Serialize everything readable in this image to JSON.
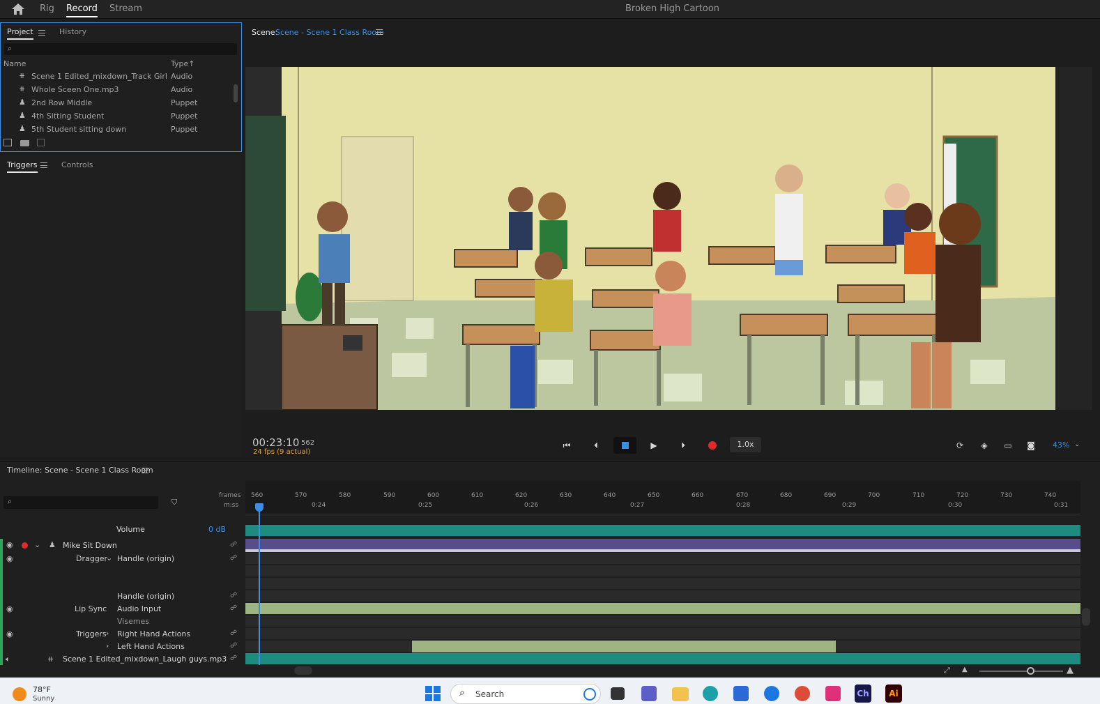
{
  "topbar": {
    "nav": [
      "Rig",
      "Record",
      "Stream"
    ],
    "active": "Record",
    "app_title": "Broken High Cartoon"
  },
  "project_panel": {
    "tabs": [
      "Project",
      "History"
    ],
    "columns": {
      "name": "Name",
      "type": "Type"
    },
    "items": [
      {
        "name": "Scene 1 Edited_mixdown_Track Girls...",
        "type": "Audio",
        "icon": "audio-icon"
      },
      {
        "name": "Whole Sceen One.mp3",
        "type": "Audio",
        "icon": "audio-icon"
      },
      {
        "name": "2nd Row Middle",
        "type": "Puppet",
        "icon": "puppet-icon"
      },
      {
        "name": "4th Sitting Student",
        "type": "Puppet",
        "icon": "puppet-icon"
      },
      {
        "name": "5th Student sitting down",
        "type": "Puppet",
        "icon": "puppet-icon"
      }
    ]
  },
  "triggers_panel": {
    "tabs": [
      "Triggers",
      "Controls"
    ]
  },
  "scene": {
    "label": "Scene:",
    "name": "Scene - Scene 1 Class Room"
  },
  "transport": {
    "timecode": "00:23:10",
    "frame": "562",
    "fps": "24 fps (9 actual)",
    "speed": "1.0x",
    "zoom": "43%"
  },
  "timeline": {
    "title": "Timeline: Scene - Scene 1 Class Room",
    "ruler_labels": {
      "frames": "frames",
      "mss": "m:ss"
    },
    "frame_ticks": [
      "560",
      "570",
      "580",
      "590",
      "600",
      "610",
      "620",
      "630",
      "640",
      "650",
      "660",
      "670",
      "680",
      "690",
      "700",
      "710",
      "720",
      "730",
      "740"
    ],
    "time_ticks": [
      "0:24",
      "0:25",
      "0:26",
      "0:27",
      "0:28",
      "0:29",
      "0:30",
      "0:31"
    ],
    "volume_label": "Volume",
    "volume_value": "0 dB",
    "track_name": "Mike Sit Down",
    "dragger": "Dragger",
    "handle1": "Handle (origin)",
    "handle2": "Handle (origin)",
    "lip_sync": "Lip Sync",
    "audio_input": "Audio Input",
    "visemes": "Visemes",
    "triggers": "Triggers",
    "right_hand": "Right Hand Actions",
    "left_hand": "Left Hand Actions",
    "audio_track": "Scene 1 Edited_mixdown_Laugh guys.mp3"
  },
  "taskbar": {
    "weather_temp": "78°F",
    "weather_cond": "Sunny",
    "search_label": "Search"
  },
  "colors": {
    "accent": "#3a8ee6",
    "teal_track": "#1f8a80",
    "purple_track": "#574d8a",
    "green_track": "#9db583",
    "record_red": "#e02b2b",
    "fps_orange": "#e8a53a"
  }
}
